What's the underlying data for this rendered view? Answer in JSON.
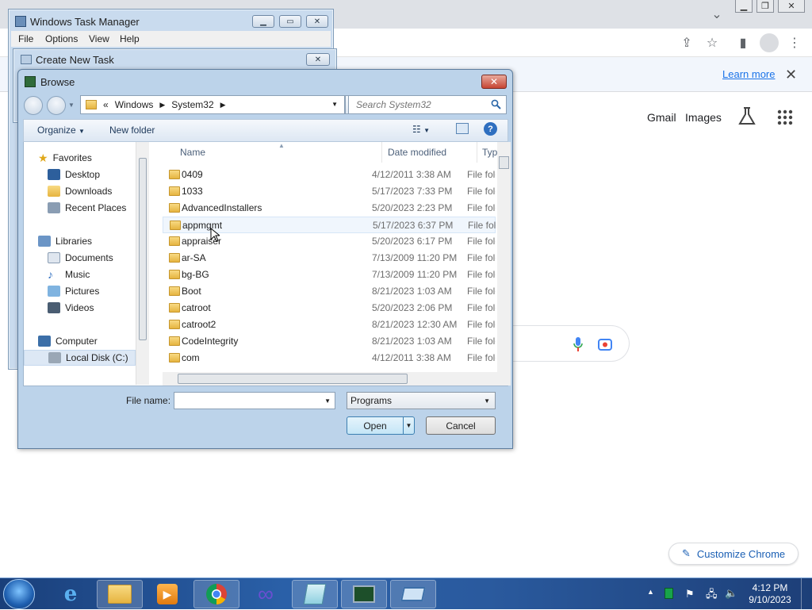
{
  "browser": {
    "toolbar_icons": [
      "share-icon",
      "star-icon",
      "sidepanel-icon",
      "profile-icon",
      "kebab-menu-icon"
    ],
    "infobar": {
      "learn_more": "Learn more"
    },
    "google": {
      "gmail": "Gmail",
      "images": "Images"
    },
    "customize_label": "Customize Chrome"
  },
  "task_manager": {
    "title": "Windows Task Manager",
    "menu": [
      "File",
      "Options",
      "View",
      "Help"
    ]
  },
  "create_task": {
    "title": "Create New Task"
  },
  "browse": {
    "title": "Browse",
    "breadcrumb": {
      "chevron": "«",
      "items": [
        "Windows",
        "System32"
      ]
    },
    "search_placeholder": "Search System32",
    "commands": {
      "organize": "Organize",
      "new_folder": "New folder"
    },
    "nav_pane": {
      "favorites": "Favorites",
      "favorite_items": [
        "Desktop",
        "Downloads",
        "Recent Places"
      ],
      "libraries": "Libraries",
      "library_items": [
        "Documents",
        "Music",
        "Pictures",
        "Videos"
      ],
      "computer": "Computer",
      "computer_items": [
        "Local Disk (C:)"
      ]
    },
    "columns": {
      "name": "Name",
      "date": "Date modified",
      "type": "Type"
    },
    "files": [
      {
        "name": "0409",
        "date": "4/12/2011 3:38 AM",
        "type": "File fold"
      },
      {
        "name": "1033",
        "date": "5/17/2023 7:33 PM",
        "type": "File fold"
      },
      {
        "name": "AdvancedInstallers",
        "date": "5/20/2023 2:23 PM",
        "type": "File fold"
      },
      {
        "name": "appmgmt",
        "date": "5/17/2023 6:37 PM",
        "type": "File fold"
      },
      {
        "name": "appraiser",
        "date": "5/20/2023 6:17 PM",
        "type": "File fold"
      },
      {
        "name": "ar-SA",
        "date": "7/13/2009 11:20 PM",
        "type": "File fold"
      },
      {
        "name": "bg-BG",
        "date": "7/13/2009 11:20 PM",
        "type": "File fold"
      },
      {
        "name": "Boot",
        "date": "8/21/2023 1:03 AM",
        "type": "File fold"
      },
      {
        "name": "catroot",
        "date": "5/20/2023 2:06 PM",
        "type": "File fold"
      },
      {
        "name": "catroot2",
        "date": "8/21/2023 12:30 AM",
        "type": "File fold"
      },
      {
        "name": "CodeIntegrity",
        "date": "8/21/2023 1:03 AM",
        "type": "File fold"
      },
      {
        "name": "com",
        "date": "4/12/2011 3:38 AM",
        "type": "File fold"
      }
    ],
    "file_name_label": "File name:",
    "file_name_value": "",
    "file_type": "Programs",
    "open_label": "Open",
    "cancel_label": "Cancel"
  },
  "taskbar": {
    "time": "4:12 PM",
    "date": "9/10/2023"
  }
}
